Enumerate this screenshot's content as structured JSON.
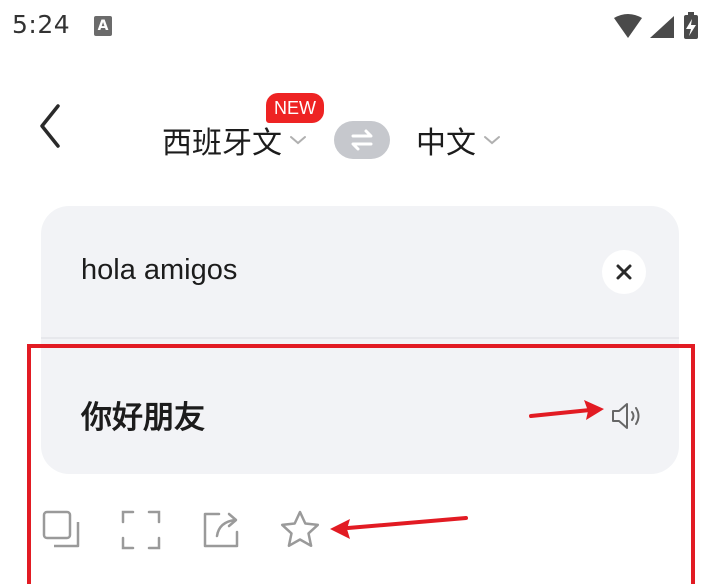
{
  "status_bar": {
    "time": "5:24",
    "app_icon_letter": "A",
    "icons": [
      "wifi-icon",
      "signal-icon",
      "battery-charging-icon"
    ]
  },
  "header": {
    "source_language": "西班牙文",
    "target_language": "中文",
    "badge": "NEW"
  },
  "translation": {
    "input_text": "hola amigos",
    "output_text": "你好朋友"
  },
  "actions": [
    "copy-icon",
    "fullscreen-icon",
    "share-icon",
    "star-icon"
  ],
  "colors": {
    "annotation": "#e21b23",
    "card_background": "#f2f3f6",
    "badge": "#ee2323",
    "icon_gray": "#9a9a9a"
  }
}
